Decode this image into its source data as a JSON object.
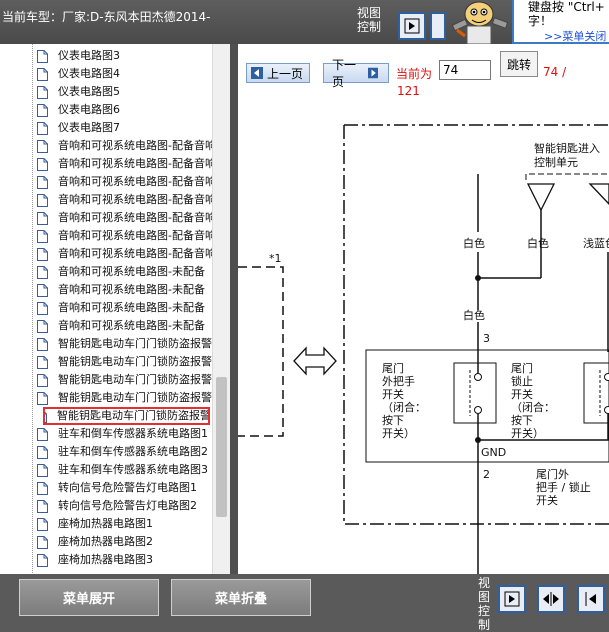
{
  "header": {
    "car_label": "当前车型：厂家:D-东风本田杰德2014-",
    "view_control": "视图控制"
  },
  "tip": {
    "text_line1": "键盘按 \"Ctrl+",
    "text_line2": "字！",
    "link": ">>菜单关闭"
  },
  "sidebar": {
    "items": [
      {
        "label": "仪表电路图3"
      },
      {
        "label": "仪表电路图4"
      },
      {
        "label": "仪表电路图5"
      },
      {
        "label": "仪表电路图6"
      },
      {
        "label": "仪表电路图7"
      },
      {
        "label": "音响和可视系统电路图-配备音响"
      },
      {
        "label": "音响和可视系统电路图-配备音响"
      },
      {
        "label": "音响和可视系统电路图-配备音响"
      },
      {
        "label": "音响和可视系统电路图-配备音响"
      },
      {
        "label": "音响和可视系统电路图-配备音响"
      },
      {
        "label": "音响和可视系统电路图-配备音响"
      },
      {
        "label": "音响和可视系统电路图-配备音响"
      },
      {
        "label": "音响和可视系统电路图-未配备"
      },
      {
        "label": "音响和可视系统电路图-未配备"
      },
      {
        "label": "音响和可视系统电路图-未配备"
      },
      {
        "label": "音响和可视系统电路图-未配备"
      },
      {
        "label": "智能钥匙电动车门门锁防盗报警"
      },
      {
        "label": "智能钥匙电动车门门锁防盗报警"
      },
      {
        "label": "智能钥匙电动车门门锁防盗报警"
      },
      {
        "label": "智能钥匙电动车门门锁防盗报警"
      },
      {
        "label": "智能钥匙电动车门门锁防盗报警"
      },
      {
        "label": "驻车和倒车传感器系统电路图1"
      },
      {
        "label": "驻车和倒车传感器系统电路图2"
      },
      {
        "label": "驻车和倒车传感器系统电路图3"
      },
      {
        "label": "转向信号危险警告灯电路图1"
      },
      {
        "label": "转向信号危险警告灯电路图2"
      },
      {
        "label": "座椅加热器电路图1"
      },
      {
        "label": "座椅加热器电路图2"
      },
      {
        "label": "座椅加热器电路图3"
      }
    ],
    "selected_index": 20
  },
  "nav": {
    "prev_label": "上一页",
    "next_label": "下一页",
    "current_prefix": "当前为",
    "page_value": "74",
    "jump_label": "跳转",
    "total_line1": "74 /",
    "total_line2": "121"
  },
  "diagram": {
    "note_mark": "*1",
    "unit_title_1": "智能钥匙进入",
    "unit_title_2": "控制单元",
    "wire_white_1": "白色",
    "wire_white_2": "白色",
    "wire_lightblue": "浅蓝色",
    "wire_white_3": "白色",
    "pin_3": "3",
    "pin_2": "2",
    "switch1_lines": [
      "尾门",
      "外把手",
      "开关",
      "（闭合：",
      "按下",
      "开关）"
    ],
    "switch2_lines": [
      "尾门",
      "锁止",
      "开关",
      "（闭合：",
      "按下",
      "开关）"
    ],
    "gnd": "GND",
    "bottom_label_lines": [
      "尾门外",
      "把手 / 锁止",
      "开关"
    ]
  },
  "bottom": {
    "expand_label": "菜单展开",
    "collapse_label": "菜单折叠",
    "view_control": "视图控制"
  },
  "colors": {
    "accent_blue": "#2e5fa0",
    "page_red": "#e01010",
    "selection_red": "#e03030",
    "toolbar_gray": "#5a5a5a"
  },
  "icons": [
    "document-icon",
    "play-icon",
    "expand-icon",
    "collapse-left-icon",
    "arrow-left-icon",
    "arrow-right-icon",
    "mascot-icon"
  ]
}
